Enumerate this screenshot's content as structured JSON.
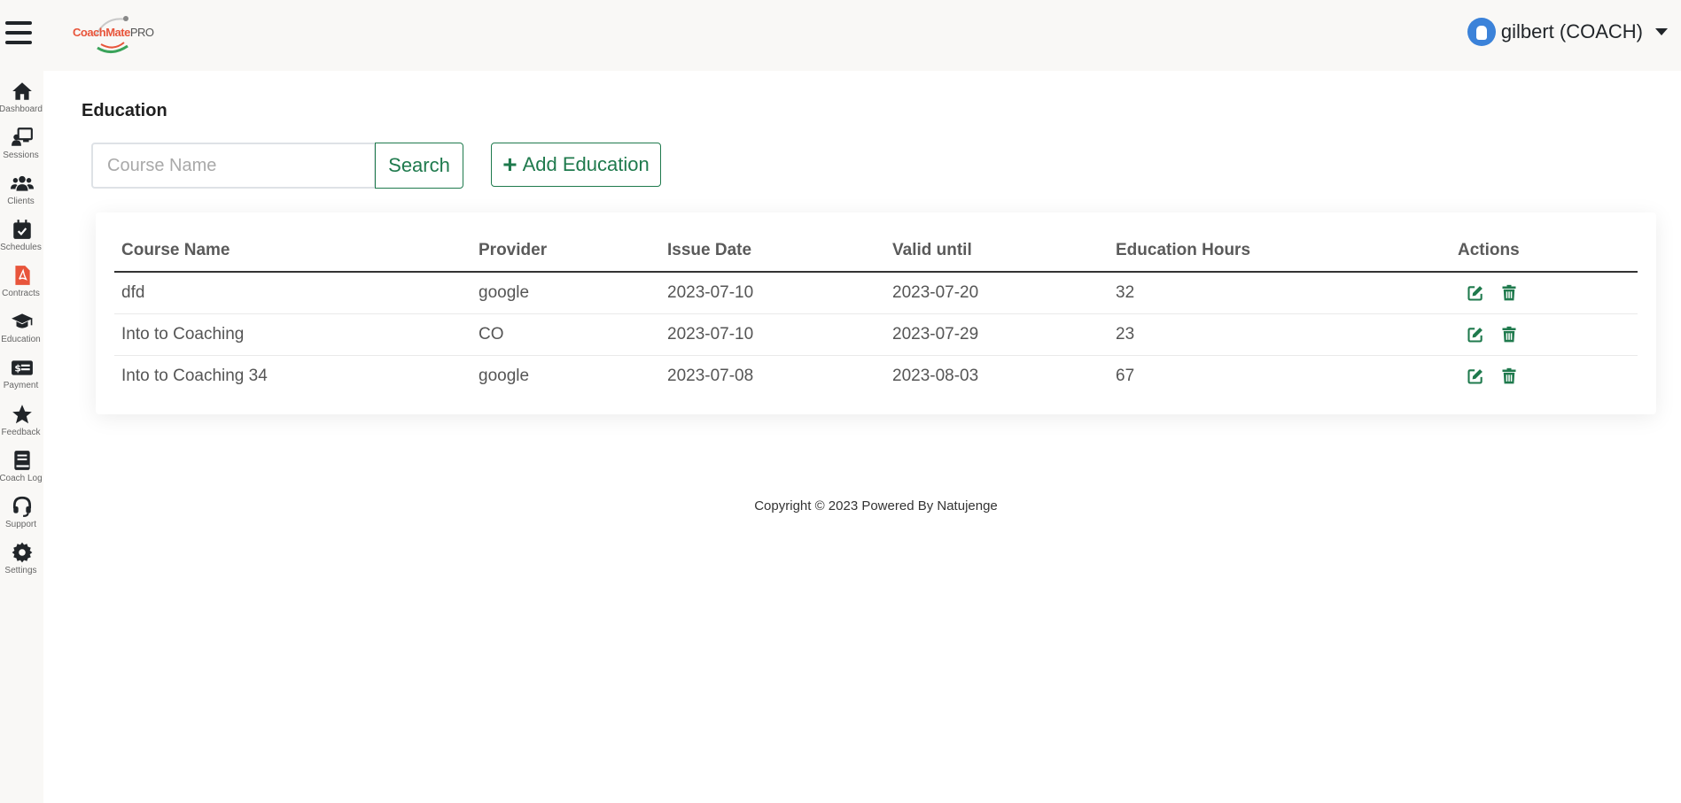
{
  "header": {
    "logo_brand": "CoachMate",
    "logo_suffix": "PRO",
    "user_name": "gilbert (COACH)"
  },
  "sidebar": {
    "items": [
      {
        "label": "Dashboard",
        "icon": "home-icon"
      },
      {
        "label": "Sessions",
        "icon": "chalkboard-user-icon"
      },
      {
        "label": "Clients",
        "icon": "users-icon"
      },
      {
        "label": "Schedules",
        "icon": "calendar-check-icon"
      },
      {
        "label": "Contracts",
        "icon": "file-pdf-icon"
      },
      {
        "label": "Education",
        "icon": "graduation-cap-icon"
      },
      {
        "label": "Payment",
        "icon": "money-check-icon"
      },
      {
        "label": "Feedback",
        "icon": "star-icon"
      },
      {
        "label": "Coach Log",
        "icon": "book-icon"
      },
      {
        "label": "Support",
        "icon": "headset-icon"
      },
      {
        "label": "Settings",
        "icon": "gear-icon"
      }
    ]
  },
  "page": {
    "title": "Education",
    "search_placeholder": "Course Name",
    "search_label": "Search",
    "add_label": "Add Education"
  },
  "table": {
    "headers": [
      "Course Name",
      "Provider",
      "Issue Date",
      "Valid until",
      "Education Hours",
      "Actions"
    ],
    "rows": [
      [
        "dfd",
        "google",
        "2023-07-10",
        "2023-07-20",
        "32"
      ],
      [
        "Into to Coaching",
        "CO",
        "2023-07-10",
        "2023-07-29",
        "23"
      ],
      [
        "Into to Coaching 34",
        "google",
        "2023-07-08",
        "2023-08-03",
        "67"
      ]
    ]
  },
  "footer": {
    "text": "Copyright © 2023 Powered By Natujenge"
  },
  "colors": {
    "accent_green": "#1f7a4d",
    "contracts_red": "#e8553b",
    "sidebar_bg": "#f9f8f6"
  }
}
